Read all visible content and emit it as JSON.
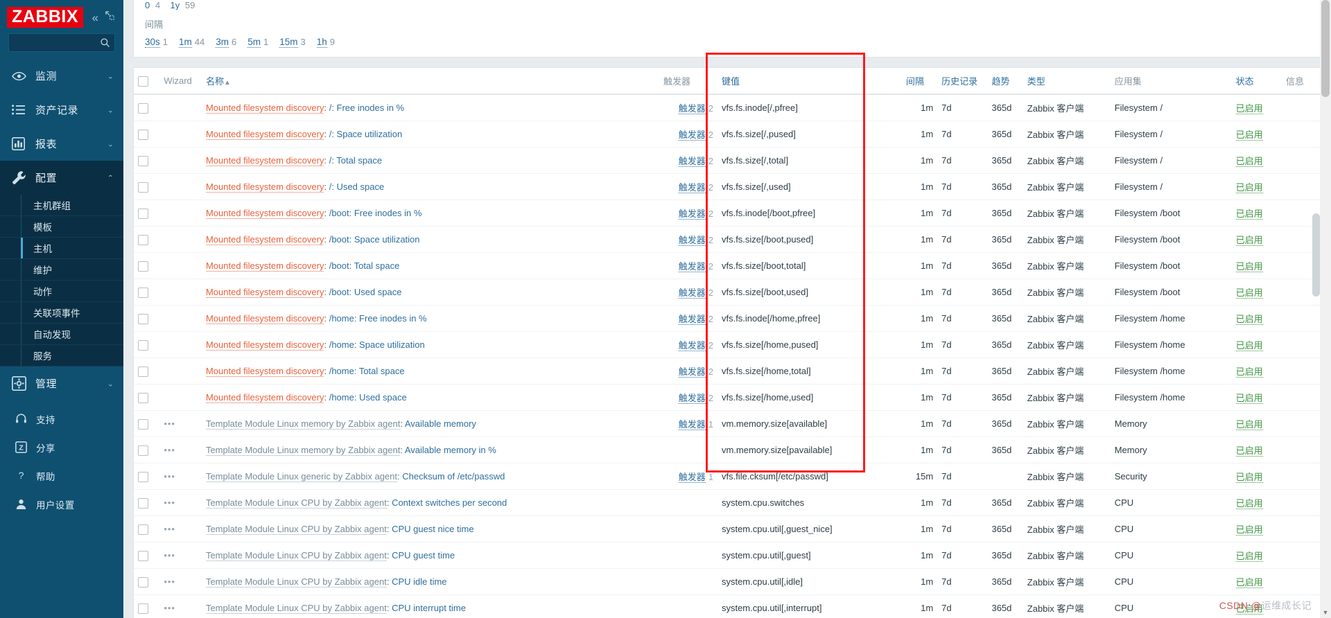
{
  "sidebar": {
    "logo": "ZABBIX",
    "collapse_icon": "chevron-double-left-icon",
    "compact_icon": "compact-view-icon",
    "search_placeholder": "",
    "search_value": "",
    "nav": [
      {
        "label": "监测",
        "icon": "eye-icon",
        "chevron": "⌄",
        "active": false
      },
      {
        "label": "资产记录",
        "icon": "list-icon",
        "chevron": "⌄",
        "active": false
      },
      {
        "label": "报表",
        "icon": "chart-icon",
        "chevron": "⌄",
        "active": false
      },
      {
        "label": "配置",
        "icon": "wrench-icon",
        "chevron": "⌃",
        "active": true
      }
    ],
    "submenu": [
      {
        "label": "主机群组",
        "active": false
      },
      {
        "label": "模板",
        "active": false
      },
      {
        "label": "主机",
        "active": true
      },
      {
        "label": "维护",
        "active": false
      },
      {
        "label": "动作",
        "active": false
      },
      {
        "label": "关联项事件",
        "active": false
      },
      {
        "label": "自动发现",
        "active": false
      },
      {
        "label": "服务",
        "active": false
      }
    ],
    "admin": {
      "label": "管理",
      "icon": "gear-icon",
      "chevron": "⌄"
    },
    "bottom": [
      {
        "label": "支持",
        "icon": "headset-icon"
      },
      {
        "label": "分享",
        "icon": "zabbix-share-icon"
      },
      {
        "label": "帮助",
        "icon": "question-icon"
      },
      {
        "label": "用户设置",
        "icon": "user-icon"
      }
    ]
  },
  "filter": {
    "clipped_row": {
      "left_label": "0",
      "left_count": "4",
      "right_label": "1y",
      "right_count": "59"
    },
    "interval_label": "间隔",
    "interval_chips": [
      {
        "label": "30s",
        "count": "1"
      },
      {
        "label": "1m",
        "count": "44"
      },
      {
        "label": "3m",
        "count": "6"
      },
      {
        "label": "5m",
        "count": "1"
      },
      {
        "label": "15m",
        "count": "3"
      },
      {
        "label": "1h",
        "count": "9"
      }
    ]
  },
  "table": {
    "headers": {
      "wizard": "Wizard",
      "name": "名称",
      "sort_arrow": "▲",
      "triggers": "触发器",
      "key": "键值",
      "interval": "间隔",
      "history": "历史记录",
      "trends": "趋势",
      "type": "类型",
      "applications": "应用集",
      "status": "状态",
      "info": "信息"
    },
    "rows": [
      {
        "wizard": "",
        "prefix": "Mounted filesystem discovery",
        "prefix_style": "red",
        "name": "/: Free inodes in %",
        "trigger": "触发器",
        "trigger_count": "2",
        "key": "vfs.fs.inode[/,pfree]",
        "interval": "1m",
        "history": "7d",
        "trends": "365d",
        "type": "Zabbix 客户端",
        "app": "Filesystem /",
        "status": "已启用"
      },
      {
        "wizard": "",
        "prefix": "Mounted filesystem discovery",
        "prefix_style": "red",
        "name": "/: Space utilization",
        "trigger": "触发器",
        "trigger_count": "2",
        "key": "vfs.fs.size[/,pused]",
        "interval": "1m",
        "history": "7d",
        "trends": "365d",
        "type": "Zabbix 客户端",
        "app": "Filesystem /",
        "status": "已启用"
      },
      {
        "wizard": "",
        "prefix": "Mounted filesystem discovery",
        "prefix_style": "red",
        "name": "/: Total space",
        "trigger": "触发器",
        "trigger_count": "2",
        "key": "vfs.fs.size[/,total]",
        "interval": "1m",
        "history": "7d",
        "trends": "365d",
        "type": "Zabbix 客户端",
        "app": "Filesystem /",
        "status": "已启用"
      },
      {
        "wizard": "",
        "prefix": "Mounted filesystem discovery",
        "prefix_style": "red",
        "name": "/: Used space",
        "trigger": "触发器",
        "trigger_count": "2",
        "key": "vfs.fs.size[/,used]",
        "interval": "1m",
        "history": "7d",
        "trends": "365d",
        "type": "Zabbix 客户端",
        "app": "Filesystem /",
        "status": "已启用"
      },
      {
        "wizard": "",
        "prefix": "Mounted filesystem discovery",
        "prefix_style": "red",
        "name": "/boot: Free inodes in %",
        "trigger": "触发器",
        "trigger_count": "2",
        "key": "vfs.fs.inode[/boot,pfree]",
        "interval": "1m",
        "history": "7d",
        "trends": "365d",
        "type": "Zabbix 客户端",
        "app": "Filesystem /boot",
        "status": "已启用"
      },
      {
        "wizard": "",
        "prefix": "Mounted filesystem discovery",
        "prefix_style": "red",
        "name": "/boot: Space utilization",
        "trigger": "触发器",
        "trigger_count": "2",
        "key": "vfs.fs.size[/boot,pused]",
        "interval": "1m",
        "history": "7d",
        "trends": "365d",
        "type": "Zabbix 客户端",
        "app": "Filesystem /boot",
        "status": "已启用"
      },
      {
        "wizard": "",
        "prefix": "Mounted filesystem discovery",
        "prefix_style": "red",
        "name": "/boot: Total space",
        "trigger": "触发器",
        "trigger_count": "2",
        "key": "vfs.fs.size[/boot,total]",
        "interval": "1m",
        "history": "7d",
        "trends": "365d",
        "type": "Zabbix 客户端",
        "app": "Filesystem /boot",
        "status": "已启用"
      },
      {
        "wizard": "",
        "prefix": "Mounted filesystem discovery",
        "prefix_style": "red",
        "name": "/boot: Used space",
        "trigger": "触发器",
        "trigger_count": "2",
        "key": "vfs.fs.size[/boot,used]",
        "interval": "1m",
        "history": "7d",
        "trends": "365d",
        "type": "Zabbix 客户端",
        "app": "Filesystem /boot",
        "status": "已启用"
      },
      {
        "wizard": "",
        "prefix": "Mounted filesystem discovery",
        "prefix_style": "red",
        "name": "/home: Free inodes in %",
        "trigger": "触发器",
        "trigger_count": "2",
        "key": "vfs.fs.inode[/home,pfree]",
        "interval": "1m",
        "history": "7d",
        "trends": "365d",
        "type": "Zabbix 客户端",
        "app": "Filesystem /home",
        "status": "已启用"
      },
      {
        "wizard": "",
        "prefix": "Mounted filesystem discovery",
        "prefix_style": "red",
        "name": "/home: Space utilization",
        "trigger": "触发器",
        "trigger_count": "2",
        "key": "vfs.fs.size[/home,pused]",
        "interval": "1m",
        "history": "7d",
        "trends": "365d",
        "type": "Zabbix 客户端",
        "app": "Filesystem /home",
        "status": "已启用"
      },
      {
        "wizard": "",
        "prefix": "Mounted filesystem discovery",
        "prefix_style": "red",
        "name": "/home: Total space",
        "trigger": "触发器",
        "trigger_count": "2",
        "key": "vfs.fs.size[/home,total]",
        "interval": "1m",
        "history": "7d",
        "trends": "365d",
        "type": "Zabbix 客户端",
        "app": "Filesystem /home",
        "status": "已启用"
      },
      {
        "wizard": "",
        "prefix": "Mounted filesystem discovery",
        "prefix_style": "red",
        "name": "/home: Used space",
        "trigger": "触发器",
        "trigger_count": "2",
        "key": "vfs.fs.size[/home,used]",
        "interval": "1m",
        "history": "7d",
        "trends": "365d",
        "type": "Zabbix 客户端",
        "app": "Filesystem /home",
        "status": "已启用"
      },
      {
        "wizard": "•••",
        "prefix": "Template Module Linux memory by Zabbix agent",
        "prefix_style": "gray",
        "name": "Available memory",
        "trigger": "触发器",
        "trigger_count": "1",
        "key": "vm.memory.size[available]",
        "interval": "1m",
        "history": "7d",
        "trends": "365d",
        "type": "Zabbix 客户端",
        "app": "Memory",
        "status": "已启用"
      },
      {
        "wizard": "•••",
        "prefix": "Template Module Linux memory by Zabbix agent",
        "prefix_style": "gray",
        "name": "Available memory in %",
        "trigger": "",
        "trigger_count": "",
        "key": "vm.memory.size[pavailable]",
        "interval": "1m",
        "history": "7d",
        "trends": "365d",
        "type": "Zabbix 客户端",
        "app": "Memory",
        "status": "已启用"
      },
      {
        "wizard": "•••",
        "prefix": "Template Module Linux generic by Zabbix agent",
        "prefix_style": "gray",
        "name": "Checksum of /etc/passwd",
        "trigger": "触发器",
        "trigger_count": "1",
        "key": "vfs.file.cksum[/etc/passwd]",
        "interval": "15m",
        "history": "7d",
        "trends": "",
        "type": "Zabbix 客户端",
        "app": "Security",
        "status": "已启用"
      },
      {
        "wizard": "•••",
        "prefix": "Template Module Linux CPU by Zabbix agent",
        "prefix_style": "gray",
        "name": "Context switches per second",
        "trigger": "",
        "trigger_count": "",
        "key": "system.cpu.switches",
        "interval": "1m",
        "history": "7d",
        "trends": "365d",
        "type": "Zabbix 客户端",
        "app": "CPU",
        "status": "已启用"
      },
      {
        "wizard": "•••",
        "prefix": "Template Module Linux CPU by Zabbix agent",
        "prefix_style": "gray",
        "name": "CPU guest nice time",
        "trigger": "",
        "trigger_count": "",
        "key": "system.cpu.util[,guest_nice]",
        "interval": "1m",
        "history": "7d",
        "trends": "365d",
        "type": "Zabbix 客户端",
        "app": "CPU",
        "status": "已启用"
      },
      {
        "wizard": "•••",
        "prefix": "Template Module Linux CPU by Zabbix agent",
        "prefix_style": "gray",
        "name": "CPU guest time",
        "trigger": "",
        "trigger_count": "",
        "key": "system.cpu.util[,guest]",
        "interval": "1m",
        "history": "7d",
        "trends": "365d",
        "type": "Zabbix 客户端",
        "app": "CPU",
        "status": "已启用"
      },
      {
        "wizard": "•••",
        "prefix": "Template Module Linux CPU by Zabbix agent",
        "prefix_style": "gray",
        "name": "CPU idle time",
        "trigger": "",
        "trigger_count": "",
        "key": "system.cpu.util[,idle]",
        "interval": "1m",
        "history": "7d",
        "trends": "365d",
        "type": "Zabbix 客户端",
        "app": "CPU",
        "status": "已启用"
      },
      {
        "wizard": "•••",
        "prefix": "Template Module Linux CPU by Zabbix agent",
        "prefix_style": "gray",
        "name": "CPU interrupt time",
        "trigger": "",
        "trigger_count": "",
        "key": "system.cpu.util[,interrupt]",
        "interval": "1m",
        "history": "7d",
        "trends": "365d",
        "type": "Zabbix 客户端",
        "app": "CPU",
        "status": "已启用"
      }
    ]
  },
  "annotation": {
    "highlight_color": "#ff1a1a",
    "name": "key-column-highlight"
  },
  "watermark": {
    "prefix": "CSDN @",
    "text": "运维成长记"
  },
  "colors": {
    "brand_red": "#e8000f",
    "sidebar": "#0f5071",
    "link": "#2e6e9e",
    "status_ok": "#3e9440",
    "template_red": "#e8613c"
  }
}
